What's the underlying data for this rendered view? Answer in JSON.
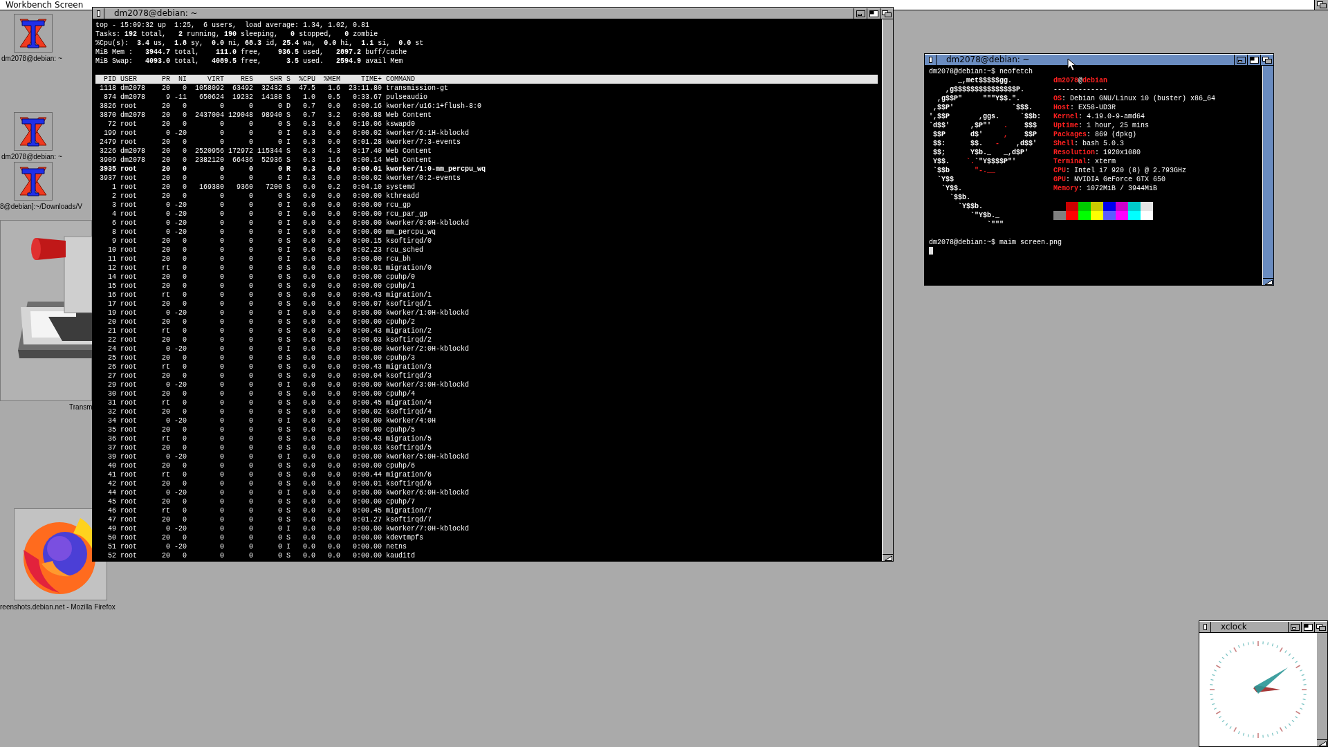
{
  "screen_bar": {
    "title": "Workbench Screen"
  },
  "desktop_icons": [
    {
      "kind": "terminal",
      "label": "dm2078@debian: ~"
    },
    {
      "kind": "terminal",
      "label": "dm2078@debian: ~"
    },
    {
      "kind": "terminal",
      "label": "8@debian]:~/Downloads/V"
    },
    {
      "kind": "download",
      "label": "Transm"
    },
    {
      "kind": "browser",
      "label": "reenshots.debian.net - Mozilla Firefox"
    }
  ],
  "top_window": {
    "title": "dm2078@debian: ~",
    "summary": [
      "top - 15:09:32 up  1:25,  6 users,  load average: 1.34, 1.02, 0.81",
      "Tasks: **192** total,   **2** running, **190** sleeping,   **0** stopped,   **0** zombie",
      "%Cpu(s):  **3.4** us,  **1.8** sy,  **0.0** ni, **68.3** id, **25.4** wa,  **0.0** hi,  **1.1** si,  **0.0** st",
      "MiB Mem :   **3944.7** total,    **111.0** free,    **936.5** used,   **2897.2** buff/cache",
      "MiB Swap:   **4093.0** total,   **4089.5** free,      **3.5** used.   **2594.9** avail Mem"
    ],
    "table": {
      "columns": [
        "PID",
        "USER",
        "PR",
        "NI",
        "VIRT",
        "RES",
        "SHR",
        "S",
        "%CPU",
        "%MEM",
        "TIME+",
        "COMMAND"
      ],
      "rows": [
        {
          "cells": [
            "1118",
            "dm2078",
            "20",
            "0",
            "1058092",
            "63492",
            "32432",
            "S",
            "47.5",
            "1.6",
            "23:11.80",
            "transmission-gt"
          ],
          "highlighted": false
        },
        {
          "cells": [
            "874",
            "dm2078",
            "9",
            "-11",
            "650624",
            "19232",
            "14188",
            "S",
            "1.0",
            "0.5",
            "0:33.67",
            "pulseaudio"
          ],
          "highlighted": false
        },
        {
          "cells": [
            "3826",
            "root",
            "20",
            "0",
            "0",
            "0",
            "0",
            "D",
            "0.7",
            "0.0",
            "0:00.16",
            "kworker/u16:1+flush-8:0"
          ],
          "highlighted": false
        },
        {
          "cells": [
            "3870",
            "dm2078",
            "20",
            "0",
            "2437004",
            "129048",
            "98940",
            "S",
            "0.7",
            "3.2",
            "0:00.88",
            "Web Content"
          ],
          "highlighted": false
        },
        {
          "cells": [
            "72",
            "root",
            "20",
            "0",
            "0",
            "0",
            "0",
            "S",
            "0.3",
            "0.0",
            "0:10.06",
            "kswapd0"
          ],
          "highlighted": false
        },
        {
          "cells": [
            "199",
            "root",
            "0",
            "-20",
            "0",
            "0",
            "0",
            "I",
            "0.3",
            "0.0",
            "0:00.02",
            "kworker/6:1H-kblockd"
          ],
          "highlighted": false
        },
        {
          "cells": [
            "2479",
            "root",
            "20",
            "0",
            "0",
            "0",
            "0",
            "I",
            "0.3",
            "0.0",
            "0:01.28",
            "kworker/7:3-events"
          ],
          "highlighted": false
        },
        {
          "cells": [
            "3226",
            "dm2078",
            "20",
            "0",
            "2520956",
            "172972",
            "115344",
            "S",
            "0.3",
            "4.3",
            "0:17.40",
            "Web Content"
          ],
          "highlighted": false
        },
        {
          "cells": [
            "3909",
            "dm2078",
            "20",
            "0",
            "2382120",
            "66436",
            "52936",
            "S",
            "0.3",
            "1.6",
            "0:00.14",
            "Web Content"
          ],
          "highlighted": false
        },
        {
          "cells": [
            "3935",
            "root",
            "20",
            "0",
            "0",
            "0",
            "0",
            "R",
            "0.3",
            "0.0",
            "0:00.01",
            "kworker/1:0-mm_percpu_wq"
          ],
          "highlighted": true
        },
        {
          "cells": [
            "3937",
            "root",
            "20",
            "0",
            "0",
            "0",
            "0",
            "I",
            "0.3",
            "0.0",
            "0:00.02",
            "kworker/0:2-events"
          ],
          "highlighted": false
        },
        {
          "cells": [
            "1",
            "root",
            "20",
            "0",
            "169380",
            "9360",
            "7200",
            "S",
            "0.0",
            "0.2",
            "0:04.10",
            "systemd"
          ],
          "highlighted": false
        },
        {
          "cells": [
            "2",
            "root",
            "20",
            "0",
            "0",
            "0",
            "0",
            "S",
            "0.0",
            "0.0",
            "0:00.00",
            "kthreadd"
          ],
          "highlighted": false
        },
        {
          "cells": [
            "3",
            "root",
            "0",
            "-20",
            "0",
            "0",
            "0",
            "I",
            "0.0",
            "0.0",
            "0:00.00",
            "rcu_gp"
          ],
          "highlighted": false
        },
        {
          "cells": [
            "4",
            "root",
            "0",
            "-20",
            "0",
            "0",
            "0",
            "I",
            "0.0",
            "0.0",
            "0:00.00",
            "rcu_par_gp"
          ],
          "highlighted": false
        },
        {
          "cells": [
            "6",
            "root",
            "0",
            "-20",
            "0",
            "0",
            "0",
            "I",
            "0.0",
            "0.0",
            "0:00.00",
            "kworker/0:0H-kblockd"
          ],
          "highlighted": false
        },
        {
          "cells": [
            "8",
            "root",
            "0",
            "-20",
            "0",
            "0",
            "0",
            "I",
            "0.0",
            "0.0",
            "0:00.00",
            "mm_percpu_wq"
          ],
          "highlighted": false
        },
        {
          "cells": [
            "9",
            "root",
            "20",
            "0",
            "0",
            "0",
            "0",
            "S",
            "0.0",
            "0.0",
            "0:00.15",
            "ksoftirqd/0"
          ],
          "highlighted": false
        },
        {
          "cells": [
            "10",
            "root",
            "20",
            "0",
            "0",
            "0",
            "0",
            "I",
            "0.0",
            "0.0",
            "0:02.23",
            "rcu_sched"
          ],
          "highlighted": false
        },
        {
          "cells": [
            "11",
            "root",
            "20",
            "0",
            "0",
            "0",
            "0",
            "I",
            "0.0",
            "0.0",
            "0:00.00",
            "rcu_bh"
          ],
          "highlighted": false
        },
        {
          "cells": [
            "12",
            "root",
            "rt",
            "0",
            "0",
            "0",
            "0",
            "S",
            "0.0",
            "0.0",
            "0:00.01",
            "migration/0"
          ],
          "highlighted": false
        },
        {
          "cells": [
            "14",
            "root",
            "20",
            "0",
            "0",
            "0",
            "0",
            "S",
            "0.0",
            "0.0",
            "0:00.00",
            "cpuhp/0"
          ],
          "highlighted": false
        },
        {
          "cells": [
            "15",
            "root",
            "20",
            "0",
            "0",
            "0",
            "0",
            "S",
            "0.0",
            "0.0",
            "0:00.00",
            "cpuhp/1"
          ],
          "highlighted": false
        },
        {
          "cells": [
            "16",
            "root",
            "rt",
            "0",
            "0",
            "0",
            "0",
            "S",
            "0.0",
            "0.0",
            "0:00.43",
            "migration/1"
          ],
          "highlighted": false
        },
        {
          "cells": [
            "17",
            "root",
            "20",
            "0",
            "0",
            "0",
            "0",
            "S",
            "0.0",
            "0.0",
            "0:00.07",
            "ksoftirqd/1"
          ],
          "highlighted": false
        },
        {
          "cells": [
            "19",
            "root",
            "0",
            "-20",
            "0",
            "0",
            "0",
            "I",
            "0.0",
            "0.0",
            "0:00.00",
            "kworker/1:0H-kblockd"
          ],
          "highlighted": false
        },
        {
          "cells": [
            "20",
            "root",
            "20",
            "0",
            "0",
            "0",
            "0",
            "S",
            "0.0",
            "0.0",
            "0:00.00",
            "cpuhp/2"
          ],
          "highlighted": false
        },
        {
          "cells": [
            "21",
            "root",
            "rt",
            "0",
            "0",
            "0",
            "0",
            "S",
            "0.0",
            "0.0",
            "0:00.43",
            "migration/2"
          ],
          "highlighted": false
        },
        {
          "cells": [
            "22",
            "root",
            "20",
            "0",
            "0",
            "0",
            "0",
            "S",
            "0.0",
            "0.0",
            "0:00.03",
            "ksoftirqd/2"
          ],
          "highlighted": false
        },
        {
          "cells": [
            "24",
            "root",
            "0",
            "-20",
            "0",
            "0",
            "0",
            "I",
            "0.0",
            "0.0",
            "0:00.00",
            "kworker/2:0H-kblockd"
          ],
          "highlighted": false
        },
        {
          "cells": [
            "25",
            "root",
            "20",
            "0",
            "0",
            "0",
            "0",
            "S",
            "0.0",
            "0.0",
            "0:00.00",
            "cpuhp/3"
          ],
          "highlighted": false
        },
        {
          "cells": [
            "26",
            "root",
            "rt",
            "0",
            "0",
            "0",
            "0",
            "S",
            "0.0",
            "0.0",
            "0:00.43",
            "migration/3"
          ],
          "highlighted": false
        },
        {
          "cells": [
            "27",
            "root",
            "20",
            "0",
            "0",
            "0",
            "0",
            "S",
            "0.0",
            "0.0",
            "0:00.04",
            "ksoftirqd/3"
          ],
          "highlighted": false
        },
        {
          "cells": [
            "29",
            "root",
            "0",
            "-20",
            "0",
            "0",
            "0",
            "I",
            "0.0",
            "0.0",
            "0:00.00",
            "kworker/3:0H-kblockd"
          ],
          "highlighted": false
        },
        {
          "cells": [
            "30",
            "root",
            "20",
            "0",
            "0",
            "0",
            "0",
            "S",
            "0.0",
            "0.0",
            "0:00.00",
            "cpuhp/4"
          ],
          "highlighted": false
        },
        {
          "cells": [
            "31",
            "root",
            "rt",
            "0",
            "0",
            "0",
            "0",
            "S",
            "0.0",
            "0.0",
            "0:00.45",
            "migration/4"
          ],
          "highlighted": false
        },
        {
          "cells": [
            "32",
            "root",
            "20",
            "0",
            "0",
            "0",
            "0",
            "S",
            "0.0",
            "0.0",
            "0:00.02",
            "ksoftirqd/4"
          ],
          "highlighted": false
        },
        {
          "cells": [
            "34",
            "root",
            "0",
            "-20",
            "0",
            "0",
            "0",
            "I",
            "0.0",
            "0.0",
            "0:00.00",
            "kworker/4:0H"
          ],
          "highlighted": false
        },
        {
          "cells": [
            "35",
            "root",
            "20",
            "0",
            "0",
            "0",
            "0",
            "S",
            "0.0",
            "0.0",
            "0:00.00",
            "cpuhp/5"
          ],
          "highlighted": false
        },
        {
          "cells": [
            "36",
            "root",
            "rt",
            "0",
            "0",
            "0",
            "0",
            "S",
            "0.0",
            "0.0",
            "0:00.43",
            "migration/5"
          ],
          "highlighted": false
        },
        {
          "cells": [
            "37",
            "root",
            "20",
            "0",
            "0",
            "0",
            "0",
            "S",
            "0.0",
            "0.0",
            "0:00.03",
            "ksoftirqd/5"
          ],
          "highlighted": false
        },
        {
          "cells": [
            "39",
            "root",
            "0",
            "-20",
            "0",
            "0",
            "0",
            "I",
            "0.0",
            "0.0",
            "0:00.00",
            "kworker/5:0H-kblockd"
          ],
          "highlighted": false
        },
        {
          "cells": [
            "40",
            "root",
            "20",
            "0",
            "0",
            "0",
            "0",
            "S",
            "0.0",
            "0.0",
            "0:00.00",
            "cpuhp/6"
          ],
          "highlighted": false
        },
        {
          "cells": [
            "41",
            "root",
            "rt",
            "0",
            "0",
            "0",
            "0",
            "S",
            "0.0",
            "0.0",
            "0:00.44",
            "migration/6"
          ],
          "highlighted": false
        },
        {
          "cells": [
            "42",
            "root",
            "20",
            "0",
            "0",
            "0",
            "0",
            "S",
            "0.0",
            "0.0",
            "0:00.01",
            "ksoftirqd/6"
          ],
          "highlighted": false
        },
        {
          "cells": [
            "44",
            "root",
            "0",
            "-20",
            "0",
            "0",
            "0",
            "I",
            "0.0",
            "0.0",
            "0:00.00",
            "kworker/6:0H-kblockd"
          ],
          "highlighted": false
        },
        {
          "cells": [
            "45",
            "root",
            "20",
            "0",
            "0",
            "0",
            "0",
            "S",
            "0.0",
            "0.0",
            "0:00.00",
            "cpuhp/7"
          ],
          "highlighted": false
        },
        {
          "cells": [
            "46",
            "root",
            "rt",
            "0",
            "0",
            "0",
            "0",
            "S",
            "0.0",
            "0.0",
            "0:00.45",
            "migration/7"
          ],
          "highlighted": false
        },
        {
          "cells": [
            "47",
            "root",
            "20",
            "0",
            "0",
            "0",
            "0",
            "S",
            "0.0",
            "0.0",
            "0:01.27",
            "ksoftirqd/7"
          ],
          "highlighted": false
        },
        {
          "cells": [
            "49",
            "root",
            "0",
            "-20",
            "0",
            "0",
            "0",
            "I",
            "0.0",
            "0.0",
            "0:00.00",
            "kworker/7:0H-kblockd"
          ],
          "highlighted": false
        },
        {
          "cells": [
            "50",
            "root",
            "20",
            "0",
            "0",
            "0",
            "0",
            "S",
            "0.0",
            "0.0",
            "0:00.00",
            "kdevtmpfs"
          ],
          "highlighted": false
        },
        {
          "cells": [
            "51",
            "root",
            "0",
            "-20",
            "0",
            "0",
            "0",
            "I",
            "0.0",
            "0.0",
            "0:00.00",
            "netns"
          ],
          "highlighted": false
        },
        {
          "cells": [
            "52",
            "root",
            "20",
            "0",
            "0",
            "0",
            "0",
            "S",
            "0.0",
            "0.0",
            "0:00.00",
            "kauditd"
          ],
          "highlighted": false
        }
      ]
    }
  },
  "neofetch_window": {
    "title": "dm2078@debian: ~",
    "command_prompt": "dm2078@debian:~$ neofetch",
    "logo": [
      [
        {
          "text": "       _,met$$$$$gg.",
          "accent": false
        }
      ],
      [
        {
          "text": "    ,g$$$$$$$$$$$$$$$P.",
          "accent": false
        }
      ],
      [
        {
          "text": "  ,g$$P\"     \"\"\"Y$$.\".",
          "accent": false
        }
      ],
      [
        {
          "text": " ,$$P'              `$$$.",
          "accent": false
        }
      ],
      [
        {
          "text": "',$$P       ,ggs.     `$$b:",
          "accent": false
        }
      ],
      [
        {
          "text": "`d$$'     ,$P\"'   ",
          "accent": false
        },
        {
          "text": ".",
          "accent": true
        },
        {
          "text": "    $$$",
          "accent": false
        }
      ],
      [
        {
          "text": " $$P      d$'     ",
          "accent": false
        },
        {
          "text": ",",
          "accent": true
        },
        {
          "text": "    $$P",
          "accent": false
        }
      ],
      [
        {
          "text": " $$:      $$.   ",
          "accent": false
        },
        {
          "text": "-",
          "accent": true
        },
        {
          "text": "    ,d$$'",
          "accent": false
        }
      ],
      [
        {
          "text": " $$;      Y$b._   _,d$P'",
          "accent": false
        }
      ],
      [
        {
          "text": " Y$$.    ",
          "accent": false
        },
        {
          "text": "`.",
          "accent": true
        },
        {
          "text": "`\"Y$$$$P\"'",
          "accent": false
        }
      ],
      [
        {
          "text": " `$$b      ",
          "accent": false
        },
        {
          "text": "\"-.__",
          "accent": true
        }
      ],
      [
        {
          "text": "  `Y$$",
          "accent": false
        }
      ],
      [
        {
          "text": "   `Y$$.",
          "accent": false
        }
      ],
      [
        {
          "text": "     `$$b.",
          "accent": false
        }
      ],
      [
        {
          "text": "       `Y$$b.",
          "accent": false
        }
      ],
      [
        {
          "text": "          `\"Y$b._",
          "accent": false
        }
      ],
      [
        {
          "text": "              `\"\"\"",
          "accent": false
        }
      ]
    ],
    "header": [
      {
        "text": "dm2078",
        "accent": true
      },
      {
        "text": "@",
        "accent": false
      },
      {
        "text": "debian",
        "accent": true
      }
    ],
    "underline": "-------------",
    "info": [
      {
        "key": "OS",
        "value": ": Debian GNU/Linux 10 (buster) x86_64"
      },
      {
        "key": "Host",
        "value": ": EX58-UD3R"
      },
      {
        "key": "Kernel",
        "value": ": 4.19.0-9-amd64"
      },
      {
        "key": "Uptime",
        "value": ": 1 hour, 25 mins"
      },
      {
        "key": "Packages",
        "value": ": 869 (dpkg)"
      },
      {
        "key": "Shell",
        "value": ": bash 5.0.3"
      },
      {
        "key": "Resolution",
        "value": ": 1920x1080"
      },
      {
        "key": "Terminal",
        "value": ": xterm"
      },
      {
        "key": "CPU",
        "value": ": Intel i7 920 (8) @ 2.793GHz"
      },
      {
        "key": "GPU",
        "value": ": NVIDIA GeForce GTX 650"
      },
      {
        "key": "Memory",
        "value": ": 1072MiB / 3944MiB"
      }
    ],
    "palette": [
      [
        {
          "color": "#cc0000"
        },
        {
          "color": "#00cc00"
        },
        {
          "color": "#cccc00"
        },
        {
          "color": "#0000ee"
        },
        {
          "color": "#cc00cc"
        },
        {
          "color": "#00cccc"
        },
        {
          "color": "#e5e5e5"
        }
      ],
      [
        {
          "color": "#7f7f7f"
        },
        {
          "color": "#ff0000"
        },
        {
          "color": "#00ff00"
        },
        {
          "color": "#ffff00"
        },
        {
          "color": "#5c5cff"
        },
        {
          "color": "#ff00ff"
        },
        {
          "color": "#00ffff"
        },
        {
          "color": "#ffffff"
        }
      ]
    ],
    "second_prompt": "dm2078@debian:~$ maim screen.png"
  },
  "clock_window": {
    "title": "xclock"
  }
}
